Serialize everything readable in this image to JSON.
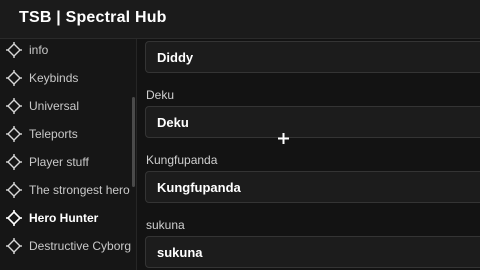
{
  "window": {
    "title": "TSB | Spectral Hub"
  },
  "sidebar": {
    "items": [
      {
        "label": "info"
      },
      {
        "label": "Keybinds"
      },
      {
        "label": "Universal"
      },
      {
        "label": "Teleports"
      },
      {
        "label": "Player stuff"
      },
      {
        "label": "The strongest hero"
      },
      {
        "label": "Hero Hunter",
        "active": true
      },
      {
        "label": "Destructive Cyborg"
      }
    ]
  },
  "main": {
    "fields": [
      {
        "label": "",
        "value": "Diddy"
      },
      {
        "label": "Deku",
        "value": "Deku"
      },
      {
        "label": "Kungfupanda",
        "value": "Kungfupanda"
      },
      {
        "label": "sukuna",
        "value": "sukuna"
      }
    ]
  },
  "icons": {
    "nav": "crosshair-icon",
    "cursor": "crosshair-cursor-icon"
  },
  "colors": {
    "background": "#131313",
    "text": "#ffffff",
    "active_text": "#ffffff"
  }
}
